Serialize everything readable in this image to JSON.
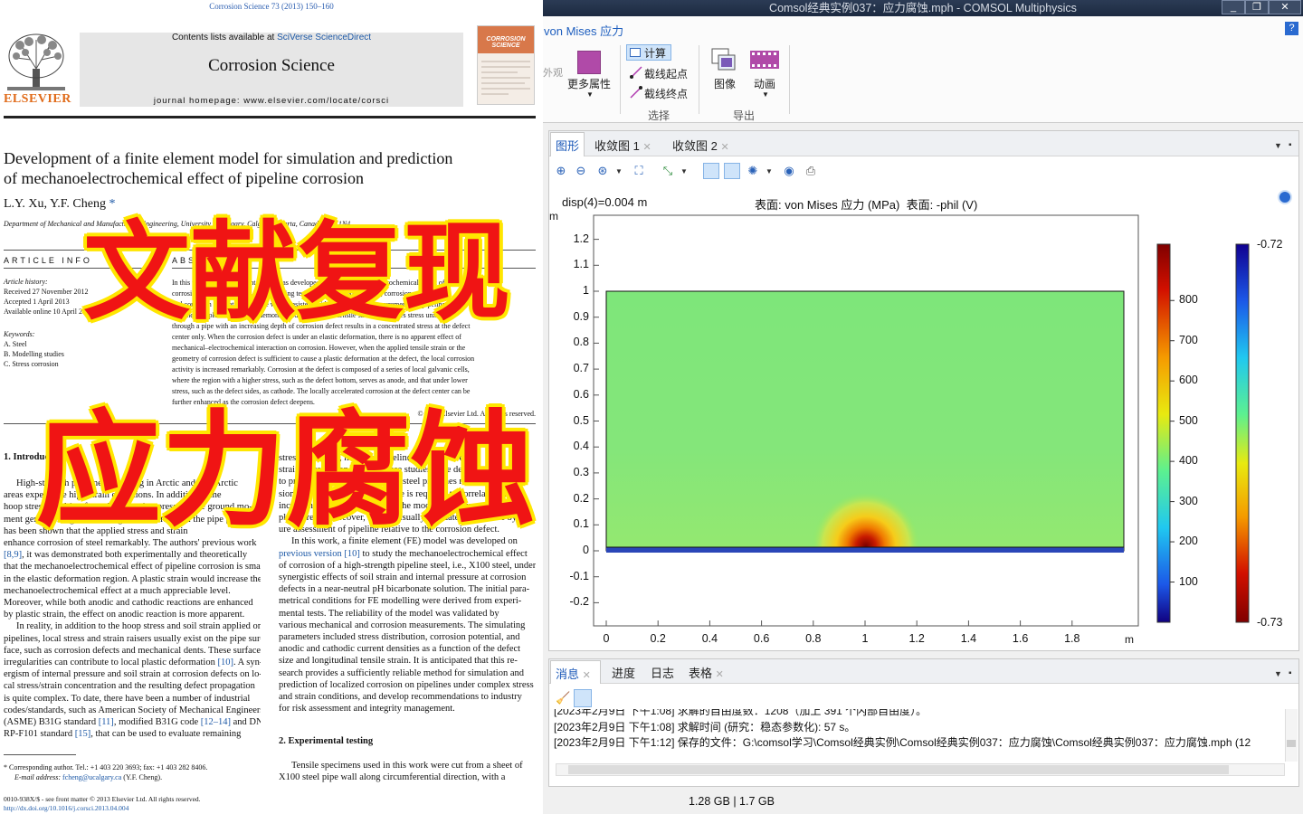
{
  "paper": {
    "journal_ref": "Corrosion Science 73 (2013) 150–160",
    "contents_prefix": "Contents lists available at ",
    "contents_link": "SciVerse ScienceDirect",
    "journal_title": "Corrosion Science",
    "journal_homepage": "journal homepage: www.elsevier.com/locate/corsci",
    "publisher": "ELSEVIER",
    "cover_text": "CORROSION SCIENCE",
    "title_line1": "Development of a finite element model for simulation and prediction",
    "title_line2": "of mechanoelectrochemical effect of pipeline corrosion",
    "authors": "L.Y. Xu, Y.F. Cheng",
    "author_mark": "*",
    "affiliation": "Department of Mechanical and Manufacturing Engineering, University of Calgary, Calgary, Alberta, Canada T2N 1N4",
    "article_info_heading": "ARTICLE INFO",
    "abstract_heading": "ABS",
    "history_label": "Article history:",
    "received": "Received 27 November 2012",
    "accepted": "Accepted 1 April 2013",
    "online": "Available online 10 April 2013",
    "keywords_label": "Keywords:",
    "kw1": "A. Steel",
    "kw2": "B. Modelling studies",
    "kw3": "C. Stress corrosion",
    "abstract_l1": "In this work, a finite element model was developed to study mechanoelectrochemical effect of pipeline",
    "abstract_l2": "corrosion by a multiphysics field coupling technique. The modeling, i.e., corrosion potential",
    "abstract_l3": "and corrosion current density, are well consistent with experimental measurements on pipeline steel in a",
    "abstract_l4": "near-neutral pH solution. It is demonstrated that, while a tensile strain distributes stress uniformly",
    "abstract_l5": "through a pipe with an increasing depth of corrosion defect results in a concentrated stress at the defect",
    "abstract_l6": "center only. When the corrosion defect is under an elastic deformation, there is no apparent effect of",
    "abstract_l7": "mechanical–electrochemical interaction on corrosion. However, when the applied tensile strain or the",
    "abstract_l8": "geometry of corrosion defect is sufficient to cause a plastic deformation at the defect, the local corrosion",
    "abstract_l9": "activity is increased remarkably. Corrosion at the defect is composed of a series of local galvanic cells,",
    "abstract_l10": "where the region with a higher stress, such as the defect bottom, serves as anode, and that under lower",
    "abstract_l11": "stress, such as the defect sides, as cathode. The locally accelerated corrosion at the defect center can be",
    "abstract_l12": "further enhanced as the corrosion defect deepens.",
    "copyright": "© 2013 Elsevier Ltd. All rights reserved.",
    "sec1": "1. Introduction",
    "l_p1": "High-strength pipelines operating in Arctic and sub-Arctic",
    "l_p2": "areas experience high strain conditions. In addition to the",
    "l_p3": "hoop stress resulting from the operating pressure, the ground mo-",
    "l_p4": "ment generates significant longitudinal strains on the pipe [1–4].",
    "l_p5": "has been shown that the applied stress and strain",
    "l_p6": "enhance corrosion of steel remarkably. The authors' previous work",
    "l_p7a": "[8,9]",
    "l_p7b": ", it was demonstrated both experimentally and theoretically",
    "l_p8": "that the mechanoelectrochemical effect of pipeline corrosion is small",
    "l_p9": "in the elastic deformation region. A plastic strain would increase the",
    "l_p10": "mechanoelectrochemical effect at a much appreciable level.",
    "l_p11": "Moreover, while both anodic and cathodic reactions are enhanced",
    "l_p12": "by plastic strain, the effect on anodic reaction is more apparent.",
    "l_p13": "In reality, in addition to the hoop stress and soil strain applied on",
    "l_p14": "pipelines, local stress and strain raisers usually exist on the pipe sur-",
    "l_p15": "face, such as corrosion defects and mechanical dents. These surface",
    "l_p16a": "irregularities can contribute to local plastic deformation ",
    "l_p16b": "[10]",
    "l_p16c": ". A syn-",
    "l_p17": "ergism of internal pressure and soil strain at corrosion defects on lo-",
    "l_p18": "cal stress/strain concentration and the resulting defect propagation",
    "l_p19": "is quite complex. To date, there have been a number of industrial",
    "l_p20": "codes/standards, such as American Society of Mechanical Engineers",
    "l_p21a": "(ASME) B31G standard ",
    "l_p21b": "[11]",
    "l_p21c": ", modified B31G code ",
    "l_p21d": "[12–14]",
    "l_p21e": " and DNV-",
    "l_p22a": "RP-F101 standard ",
    "l_p22b": "[15]",
    "l_p22c": ", that can be used to evaluate remaining",
    "r_p1": "stress and strain, nature of pipelines, and the stress/",
    "r_p2": "strain of corrosion defects, these studies have developed",
    "r_p3": "to predict the failure pressure of steel pipelines relative to corro-",
    "r_p4": "sion defects. The failure pressure is required to correlate with as",
    "r_p5": "increasing depth of defects and the models usually evaluate, as ap-",
    "r_p6": "plied stress. Moreover, models usually evaluate pipe failure by fail-",
    "r_p7": "ure assessment of pipeline relative to the corrosion defect.",
    "r_p8": "In this work, a finite element (FE) model was developed on",
    "r_p9a": "previous version ",
    "r_p9b": "[10]",
    "r_p9c": " to study the mechanoelectrochemical effect",
    "r_p10": "of corrosion of a high-strength pipeline steel, i.e., X100 steel, under",
    "r_p11": "synergistic effects of soil strain and internal pressure at corrosion",
    "r_p12": "defects in a near-neutral pH bicarbonate solution. The initial para-",
    "r_p13": "metrical conditions for FE modelling were derived from experi-",
    "r_p14": "mental tests. The reliability of the model was validated by",
    "r_p15": "various mechanical and corrosion measurements. The simulating",
    "r_p16": "parameters included stress distribution, corrosion potential, and",
    "r_p17": "anodic and cathodic current densities as a function of the defect",
    "r_p18": "size and longitudinal tensile strain. It is anticipated that this re-",
    "r_p19": "search provides a sufficiently reliable method for simulation and",
    "r_p20": "prediction of localized corrosion on pipelines under complex stress",
    "r_p21": "and strain conditions, and develop recommendations to industry",
    "r_p22": "for risk assessment and integrity management.",
    "sec2": "2. Experimental testing",
    "r_p23": "Tensile specimens used in this work were cut from a sheet of",
    "r_p24": "X100 steel pipe wall along circumferential direction, with a",
    "footnote1": "* Corresponding author. Tel.: +1 403 220 3693; fax: +1 403 282 8406.",
    "footnote2a": "E-mail address: ",
    "footnote2b": "fcheng@ucalgary.ca",
    "footnote2c": " (Y.F. Cheng).",
    "issn": "0010-938X/$ - see front matter © 2013 Elsevier Ltd. All rights reserved.",
    "doi": "http://dx.doi.org/10.1016/j.corsci.2013.04.004"
  },
  "overlay": {
    "line1": "文献复现",
    "line2": "应力腐蚀"
  },
  "comsol": {
    "window_title": "Comsol经典实例037：应力腐蚀.mph - COMSOL Multiphysics",
    "ribbon_tab": "von Mises 应力",
    "ribbon_cut_label": "外观",
    "btn_more_props": "更多属性",
    "btn_compute": "计算",
    "btn_cutline_start": "截线起点",
    "btn_cutline_end": "截线终点",
    "btn_image": "图像",
    "btn_animation": "动画",
    "group_select": "选择",
    "group_export": "导出",
    "help": "?",
    "graphics_tabs": [
      "图形",
      "收敛图 1",
      "收敛图 2"
    ],
    "plot_label_left": "disp(4)=0.004 m",
    "plot_label_right": "表面: von Mises 应力 (MPa)  表面: -phil (V)",
    "y_unit": "m",
    "x_unit": "m",
    "y_ticks": [
      "1.2",
      "1.1",
      "1",
      "0.9",
      "0.8",
      "0.7",
      "0.6",
      "0.5",
      "0.4",
      "0.3",
      "0.2",
      "0.1",
      "0",
      "-0.1",
      "-0.2"
    ],
    "x_ticks": [
      "0",
      "0.2",
      "0.4",
      "0.6",
      "0.8",
      "1",
      "1.2",
      "1.4",
      "1.6",
      "1.8"
    ],
    "colorbar1_ticks": [
      "800",
      "700",
      "600",
      "500",
      "400",
      "300",
      "200",
      "100"
    ],
    "colorbar2_top": "-0.72",
    "colorbar2_bottom": "-0.73",
    "msg_tabs": [
      "消息",
      "进度",
      "日志",
      "表格"
    ],
    "msg_line0": "[2023年2月9日 下午1:08] 求解的自由度数：1208（加上 391 个内部自由度）。",
    "msg_line1": "[2023年2月9日 下午1:08] 求解时间 (研究：稳态参数化): 57 s。",
    "msg_line2": "[2023年2月9日 下午1:12] 保存的文件：G:\\comsol学习\\Comsol经典实例\\Comsol经典实例037：应力腐蚀\\Comsol经典实例037：应力腐蚀.mph (12",
    "status_memory": "1.28 GB | 1.7 GB",
    "colors": {
      "accent": "#1a58b8",
      "overlay_red": "#f01414",
      "overlay_yellow": "#ffe600"
    }
  }
}
